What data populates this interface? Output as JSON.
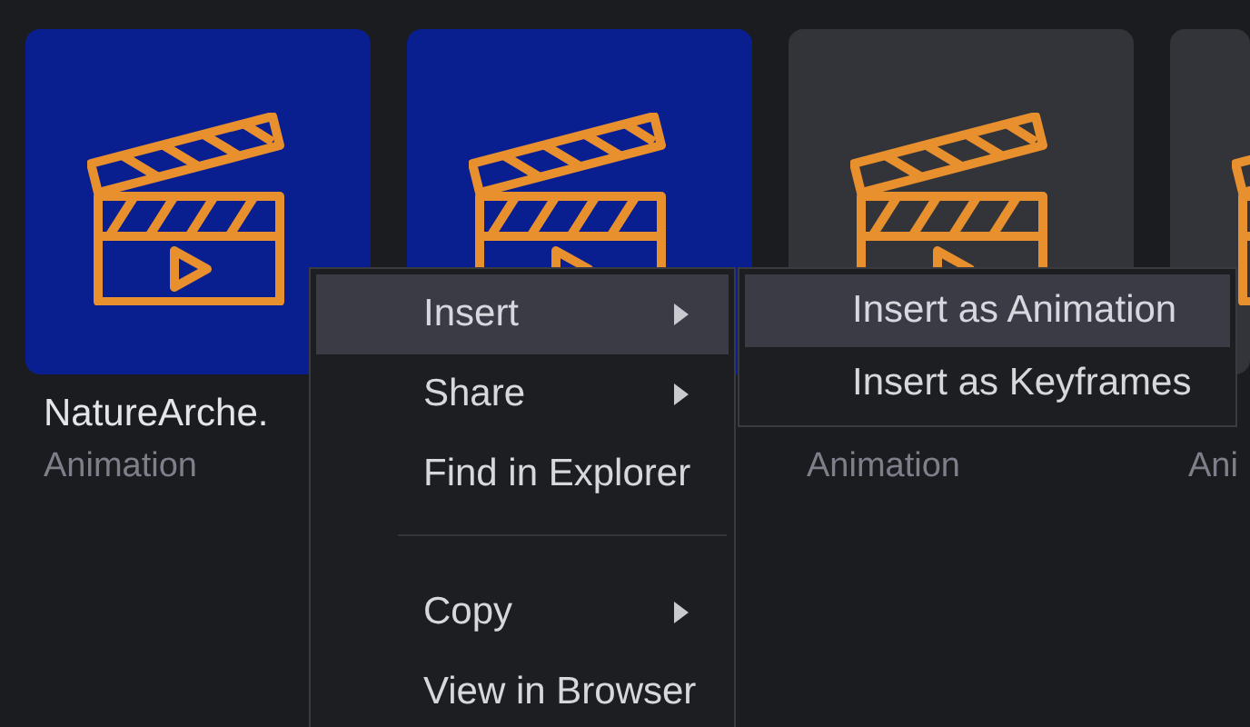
{
  "assets": [
    {
      "selected": true,
      "name": "NatureArche.",
      "type": "Animation"
    },
    {
      "selected": true
    },
    {
      "selected": false,
      "type": "Animation"
    },
    {
      "selected": false,
      "type": "Ani"
    }
  ],
  "context_menu": {
    "items": [
      {
        "kind": "item",
        "label": "Insert",
        "submenu": true,
        "selected": true
      },
      {
        "kind": "item",
        "label": "Share",
        "submenu": true,
        "selected": false
      },
      {
        "kind": "item",
        "label": "Find in Explorer",
        "selected": false
      },
      {
        "kind": "separator"
      },
      {
        "kind": "item",
        "label": "Copy",
        "submenu": true,
        "selected": false
      },
      {
        "kind": "item",
        "label": "View in Browser",
        "selected": false
      }
    ]
  },
  "submenu": {
    "items": [
      {
        "label": "Insert as Animation",
        "selected": true
      },
      {
        "label": "Insert as Keyframes",
        "selected": false
      }
    ]
  }
}
